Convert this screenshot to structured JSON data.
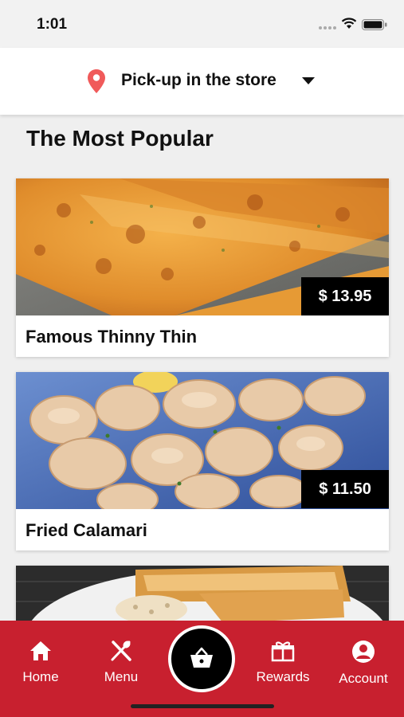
{
  "status_bar": {
    "time": "1:01"
  },
  "header": {
    "pickup_label": "Pick-up in the store"
  },
  "section": {
    "title": "The Most Popular"
  },
  "items": [
    {
      "name": "Famous Thinny Thin",
      "price": "$ 13.95"
    },
    {
      "name": "Fried Calamari",
      "price": "$ 11.50"
    }
  ],
  "nav": {
    "home": "Home",
    "menu": "Menu",
    "rewards": "Rewards",
    "account": "Account"
  },
  "colors": {
    "brand_red": "#c8202f",
    "pin": "#f05a5a"
  },
  "icons": [
    "map-pin-icon",
    "caret-down-icon",
    "home-icon",
    "utensils-icon",
    "basket-icon",
    "gift-icon",
    "account-icon",
    "wifi-icon",
    "battery-icon"
  ]
}
